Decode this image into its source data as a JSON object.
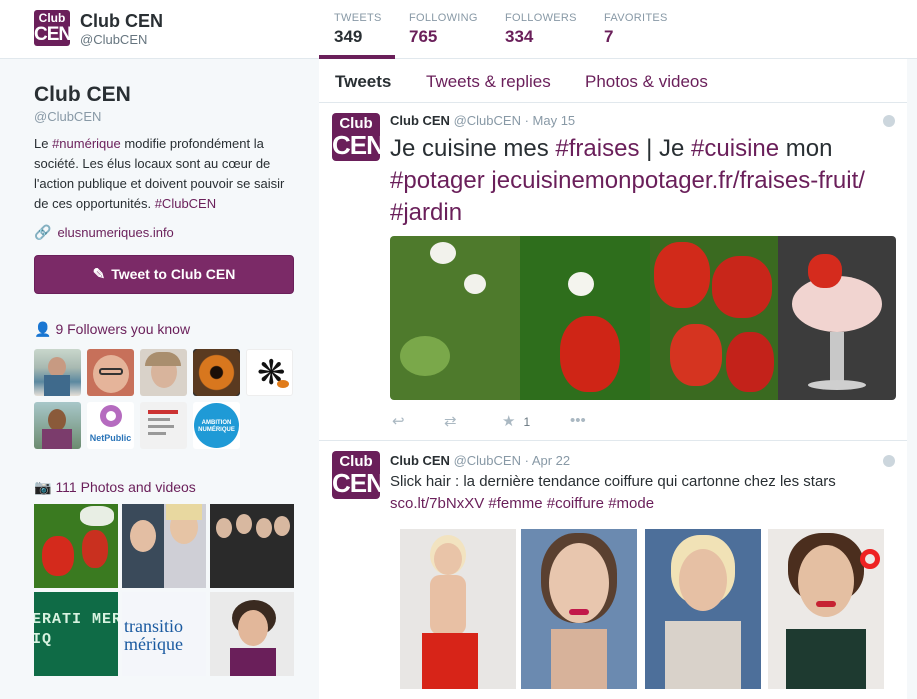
{
  "brand_color": "#6a1f5a",
  "header": {
    "logo_line1": "Club",
    "logo_line2": "CEN",
    "name": "Club CEN",
    "handle": "@ClubCEN",
    "stats": [
      {
        "label": "TWEETS",
        "value": "349"
      },
      {
        "label": "FOLLOWING",
        "value": "765"
      },
      {
        "label": "FOLLOWERS",
        "value": "334"
      },
      {
        "label": "FAVORITES",
        "value": "7"
      }
    ]
  },
  "profile": {
    "name": "Club CEN",
    "handle": "@ClubCEN",
    "bio_parts": [
      "Le ",
      "#numérique",
      " modifie profondément la société. Les élus locaux sont au cœur de l'action publique et doivent pouvoir se saisir de ces opportunités. ",
      "#ClubCEN"
    ],
    "link_icon": "link-icon",
    "link": "elusnumeriques.info",
    "tweet_button": "Tweet to Club CEN",
    "followers_icon": "person-icon",
    "followers_title": "9 Followers you know",
    "photos_icon": "camera-icon",
    "photos_title": "111 Photos and videos",
    "netpublic_label": "NetPublic",
    "ambition_label": "AMBITION NUMÉRIQUE",
    "photo_text_1": "ERATI MERIQ",
    "photo_text_2a": "transitio",
    "photo_text_2b": "mérique"
  },
  "tabs": [
    {
      "label": "Tweets"
    },
    {
      "label": "Tweets & replies"
    },
    {
      "label": "Photos & videos"
    }
  ],
  "tweets": [
    {
      "avatar_line1": "Club",
      "avatar_line2": "CEN",
      "name": "Club CEN",
      "handle": "@ClubCEN",
      "date": "· May 15",
      "text_parts": [
        "Je cuisine mes ",
        "#fraises",
        " | Je ",
        "#cuisine",
        " mon ",
        "#potager",
        " ",
        "jecuisinemonpotager.fr/fraises-fruit/",
        " ",
        "#jardin"
      ],
      "favorites": "1"
    },
    {
      "avatar_line1": "Club",
      "avatar_line2": "CEN",
      "name": "Club CEN",
      "handle": "@ClubCEN",
      "date": "· Apr 22",
      "text_parts": [
        "Slick hair : la dernière tendance coiffure qui cartonne chez les stars ",
        "sco.lt/7bNxXV",
        " ",
        "#femme",
        " ",
        "#coiffure",
        " ",
        "#mode"
      ]
    }
  ],
  "actions": {
    "reply_icon": "reply-icon",
    "retweet_icon": "retweet-icon",
    "favorite_icon": "star-icon",
    "more_icon": "more-icon"
  }
}
